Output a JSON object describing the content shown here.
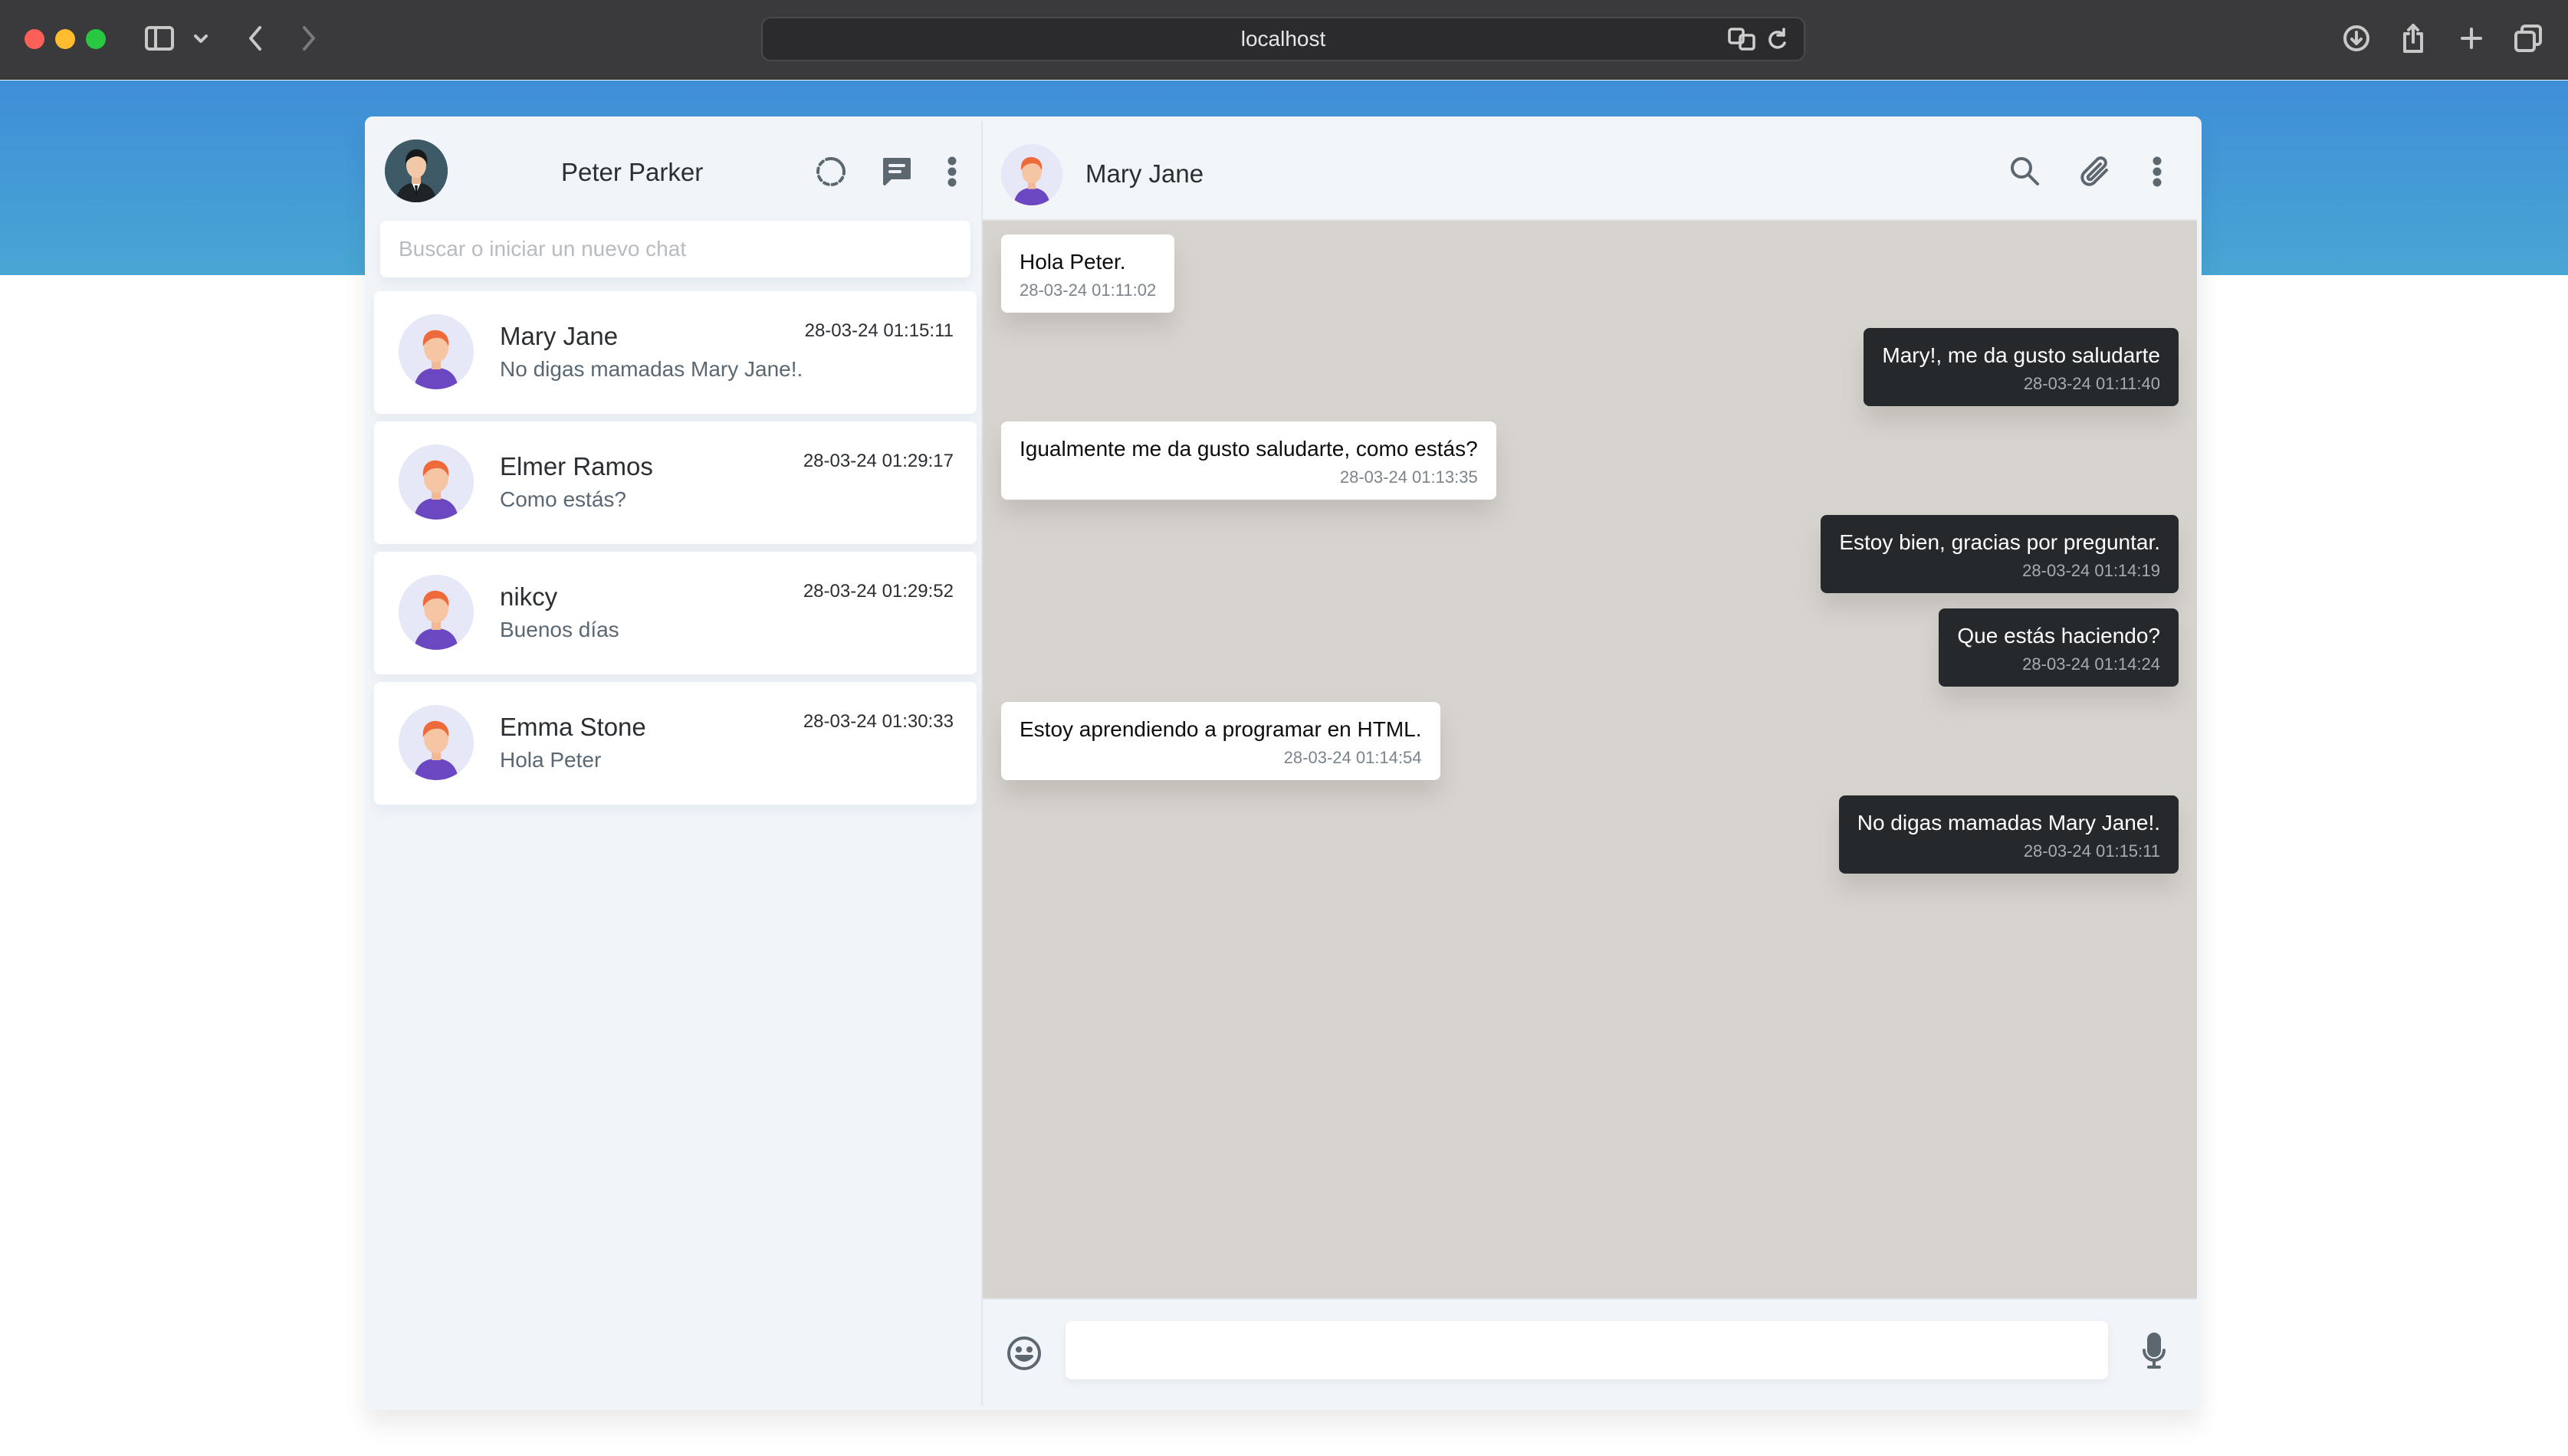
{
  "browser": {
    "url": "localhost"
  },
  "sidebar": {
    "user_name": "Peter Parker",
    "search": {
      "placeholder": "Buscar o iniciar un nuevo chat"
    },
    "chats": [
      {
        "name": "Mary Jane",
        "last_message": "No digas mamadas Mary Jane!.",
        "time": "28-03-24 01:15:11"
      },
      {
        "name": "Elmer Ramos",
        "last_message": "Como estás?",
        "time": "28-03-24 01:29:17"
      },
      {
        "name": "nikcy",
        "last_message": "Buenos días",
        "time": "28-03-24 01:29:52"
      },
      {
        "name": "Emma Stone",
        "last_message": "Hola Peter",
        "time": "28-03-24 01:30:33"
      }
    ]
  },
  "chat": {
    "contact_name": "Mary Jane",
    "messages": [
      {
        "direction": "in",
        "text": "Hola Peter.",
        "time": "28-03-24 01:11:02"
      },
      {
        "direction": "out",
        "text": "Mary!, me da gusto saludarte",
        "time": "28-03-24 01:11:40"
      },
      {
        "direction": "in",
        "text": "Igualmente me da gusto saludarte, como estás?",
        "time": "28-03-24 01:13:35"
      },
      {
        "direction": "out",
        "text": "Estoy bien, gracias por preguntar.",
        "time": "28-03-24 01:14:19"
      },
      {
        "direction": "out",
        "text": "Que estás haciendo?",
        "time": "28-03-24 01:14:24"
      },
      {
        "direction": "in",
        "text": "Estoy aprendiendo a programar en HTML.",
        "time": "28-03-24 01:14:54"
      },
      {
        "direction": "out",
        "text": "No digas mamadas Mary Jane!.",
        "time": "28-03-24 01:15:11"
      }
    ],
    "composer": {
      "value": ""
    }
  },
  "icons": {
    "refresh": "refresh-icon",
    "new_chat": "message-icon",
    "menu": "more-vertical-icon",
    "search": "search-icon",
    "attach": "paperclip-icon",
    "emoji": "emoji-icon",
    "mic": "microphone-icon"
  },
  "colors": {
    "accent": "#3f8ed8",
    "outgoing_bubble": "#25292c",
    "incoming_bubble": "#ffffff",
    "chat_background": "#d7d3ce"
  }
}
